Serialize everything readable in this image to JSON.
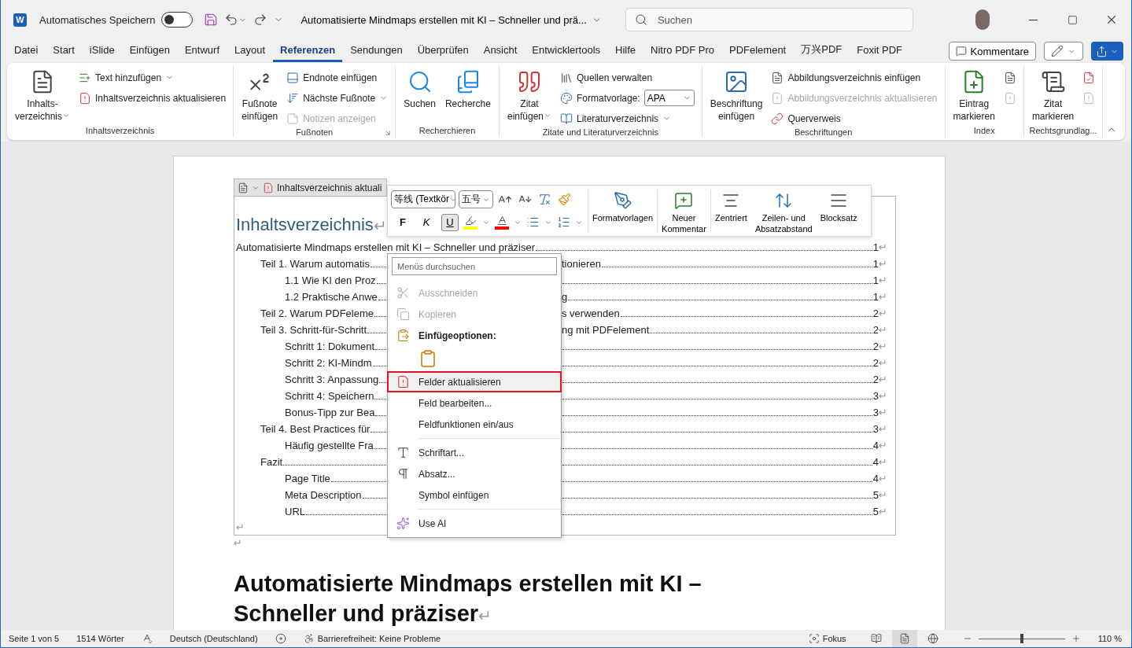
{
  "title_bar": {
    "app_icon": "W",
    "autosave": {
      "label": "Automatisches Speichern",
      "on": false
    },
    "document_title": "Automatisierte Mindmaps erstellen mit KI – Schneller und prä...",
    "search": {
      "placeholder": "Suchen"
    }
  },
  "tabs": [
    {
      "label": "Datei",
      "selected": false
    },
    {
      "label": "Start",
      "selected": false
    },
    {
      "label": "iSlide",
      "selected": false
    },
    {
      "label": "Einfügen",
      "selected": false
    },
    {
      "label": "Entwurf",
      "selected": false
    },
    {
      "label": "Layout",
      "selected": false
    },
    {
      "label": "Referenzen",
      "selected": true
    },
    {
      "label": "Sendungen",
      "selected": false
    },
    {
      "label": "Überprüfen",
      "selected": false
    },
    {
      "label": "Ansicht",
      "selected": false
    },
    {
      "label": "Entwicklertools",
      "selected": false
    },
    {
      "label": "Hilfe",
      "selected": false
    },
    {
      "label": "Nitro PDF Pro",
      "selected": false
    },
    {
      "label": "PDFelement",
      "selected": false
    },
    {
      "label": "万兴PDF",
      "selected": false
    },
    {
      "label": "Foxit PDF",
      "selected": false
    }
  ],
  "tab_actions": {
    "comments": "Kommentare"
  },
  "ribbon": {
    "groups": [
      {
        "label": "Inhaltsverzeichnis",
        "launcher": false,
        "columns": [
          {
            "kind": "large",
            "label": "Inhalts-\nverzeichnis",
            "caret": true
          },
          {
            "kind": "stack",
            "items": [
              {
                "label": "Text hinzufügen",
                "caret": true,
                "disabled": false
              },
              {
                "label": "Inhaltsverzeichnis aktualisieren",
                "caret": false,
                "disabled": false
              }
            ]
          }
        ]
      },
      {
        "label": "Fußnoten",
        "launcher": true,
        "columns": [
          {
            "kind": "large",
            "label": "Fußnote\neinfügen",
            "caret": false
          },
          {
            "kind": "stack",
            "items": [
              {
                "label": "Endnote einfügen",
                "caret": false,
                "disabled": false
              },
              {
                "label": "Nächste Fußnote",
                "caret": true,
                "disabled": false
              },
              {
                "label": "Notizen anzeigen",
                "caret": false,
                "disabled": true
              }
            ]
          }
        ]
      },
      {
        "label": "Recherchieren",
        "launcher": false,
        "columns": [
          {
            "kind": "large",
            "label": "Suchen",
            "caret": false
          },
          {
            "kind": "large",
            "label": "Recherche",
            "caret": false
          }
        ]
      },
      {
        "label": "Zitate und Literaturverzeichnis",
        "launcher": false,
        "columns": [
          {
            "kind": "large",
            "label": "Zitat\neinfügen",
            "caret": true
          },
          {
            "kind": "stack",
            "items": [
              {
                "label": "Quellen verwalten",
                "caret": false,
                "disabled": false
              },
              {
                "label": "Formatvorlage:",
                "select": "APA",
                "caret": false,
                "disabled": false
              },
              {
                "label": "Literaturverzeichnis",
                "caret": true,
                "disabled": false
              }
            ]
          }
        ]
      },
      {
        "label": "Beschriftungen",
        "launcher": false,
        "columns": [
          {
            "kind": "large",
            "label": "Beschriftung\neinfügen",
            "caret": false
          },
          {
            "kind": "stack",
            "items": [
              {
                "label": "Abbildungsverzeichnis einfügen",
                "caret": false,
                "disabled": false
              },
              {
                "label": "Abbildungsverzeichnis aktualisieren",
                "caret": false,
                "disabled": true
              },
              {
                "label": "Querverweis",
                "caret": false,
                "disabled": false
              }
            ]
          }
        ]
      },
      {
        "label": "Index",
        "launcher": false,
        "columns": [
          {
            "kind": "large",
            "label": "Eintrag\nmarkieren",
            "caret": false
          },
          {
            "kind": "stack",
            "items": [
              {
                "caret": false,
                "disabled": false
              },
              {
                "caret": false,
                "disabled": true
              }
            ]
          }
        ]
      },
      {
        "label": "Rechtsgrundlag...",
        "launcher": false,
        "columns": [
          {
            "kind": "large",
            "label": "Zitat\nmarkieren",
            "caret": false
          },
          {
            "kind": "stack",
            "items": [
              {
                "caret": false,
                "disabled": false
              },
              {
                "caret": false,
                "disabled": true
              }
            ]
          }
        ]
      }
    ]
  },
  "field_tab": {
    "label": "Inhaltsverzeichnis aktuali"
  },
  "document": {
    "toc_heading": {
      "text": "Inhaltsverzeichnis",
      "end": "↵"
    },
    "toc": [
      {
        "kind": "full",
        "text": "Automatisierte Mindmaps erstellen mit KI – Schneller und präziser",
        "page": "1",
        "end": "↵",
        "children": [
          {
            "kind": "split",
            "text": "Teil 1. Warum automatis",
            "right": "tionieren",
            "page": "1",
            "end": "↵",
            "children": [
              {
                "kind": "split",
                "text": "1.1 Wie KI den Proz",
                "page": "1",
                "end": "↵"
              },
              {
                "kind": "split",
                "text": "1.2 Praktische Anwe",
                "right": "g",
                "page": "1",
                "end": "↵"
              }
            ]
          },
          {
            "kind": "split",
            "text": "Teil 2. Warum PDFeleme",
            "right": "s verwenden",
            "page": "2",
            "end": "↵"
          },
          {
            "kind": "split",
            "text": "Teil 3. Schritt-für-Schritt",
            "right": "ng mit PDFelement",
            "page": "2",
            "end": "↵",
            "children": [
              {
                "kind": "split",
                "text": "Schritt 1: Dokument",
                "page": "2",
                "end": "↵"
              },
              {
                "kind": "split",
                "text": "Schritt 2: KI-Mindm",
                "page": "2",
                "end": "↵"
              },
              {
                "kind": "split",
                "text": "Schritt 3: Anpassung",
                "page": "2",
                "end": "↵"
              },
              {
                "kind": "split",
                "text": "Schritt 4: Speichern",
                "page": "3",
                "end": "↵"
              },
              {
                "kind": "split",
                "text": "Bonus-Tipp zur Bea",
                "page": "3",
                "end": "↵"
              }
            ]
          },
          {
            "kind": "split",
            "text": "Teil 4. Best Practices für",
            "page": "3",
            "end": "↵",
            "children": [
              {
                "kind": "split",
                "text": "Häufig gestellte Fra",
                "page": "4",
                "end": "↵"
              }
            ]
          },
          {
            "kind": "split",
            "text": "Fazit",
            "page": "4",
            "end": "↵",
            "children": [
              {
                "kind": "split",
                "text": "Page Title",
                "page": "4",
                "end": "↵"
              },
              {
                "kind": "split",
                "text": "Meta Description",
                "page": "5",
                "end": "↵"
              },
              {
                "kind": "split",
                "text": "URL",
                "page": "5",
                "end": "↵"
              }
            ]
          }
        ]
      }
    ],
    "toc_end": "↵",
    "after_toc": "↵",
    "heading": {
      "text": "Automatisierte Mindmaps erstellen mit KI – Schneller und präziser",
      "end": "↵"
    }
  },
  "mini_toolbar": {
    "font": "等线 (Textkör",
    "size": "五号",
    "format_buttons": [
      {
        "label": "F",
        "selected": false
      },
      {
        "label": "K",
        "selected": false
      },
      {
        "label": "U",
        "selected": true
      }
    ],
    "large": [
      "Formatvorlagen",
      "Neuer\nKommentar",
      "Zentriert",
      "Zeilen- und\nAbsatzabstand",
      "Blocksatz"
    ]
  },
  "context_menu": {
    "search": {
      "placeholder": "Menüs durchsuchen"
    },
    "sections": [
      [
        {
          "kind": "item",
          "label": "Ausschneiden",
          "selected": false,
          "disabled": true
        },
        {
          "kind": "item",
          "label": "Kopieren",
          "selected": false,
          "disabled": true
        },
        {
          "kind": "header",
          "label": "Einfügeoptionen:"
        },
        {
          "kind": "paste"
        },
        {
          "kind": "item",
          "label": "Felder aktualisieren",
          "selected": true,
          "disabled": false
        },
        {
          "kind": "item",
          "label": "Feld bearbeiten...",
          "selected": false,
          "disabled": false
        },
        {
          "kind": "item",
          "label": "Feldfunktionen ein/aus",
          "selected": false,
          "disabled": false
        }
      ],
      [
        {
          "kind": "item",
          "label": "Schriftart...",
          "selected": false,
          "disabled": false
        },
        {
          "kind": "item",
          "label": "Absatz...",
          "selected": false,
          "disabled": false
        },
        {
          "kind": "item",
          "label": "Symbol einfügen",
          "selected": false,
          "disabled": false
        }
      ],
      [
        {
          "kind": "item",
          "label": "Use AI",
          "selected": false,
          "disabled": false
        }
      ]
    ]
  },
  "status_bar": {
    "page": "Seite 1 von 5",
    "words": "1514 Wörter",
    "language": "Deutsch (Deutschland)",
    "accessibility": "Barrierefreiheit: Keine Probleme",
    "focus": "Fokus",
    "views": [
      {
        "selected": false
      },
      {
        "selected": true
      },
      {
        "selected": false
      }
    ],
    "zoom": {
      "level": 0.5,
      "reading": "110 %"
    }
  }
}
